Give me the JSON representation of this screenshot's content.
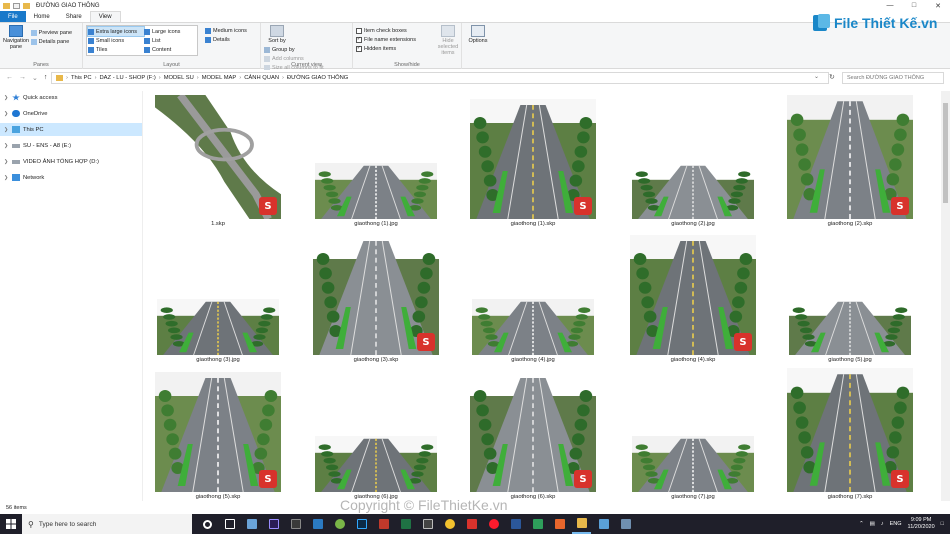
{
  "window": {
    "title": "ĐƯỜNG GIAO THÔNG"
  },
  "tabs": [
    "File",
    "Home",
    "Share",
    "View"
  ],
  "ribbon": {
    "panes": {
      "nav": "Navigation pane",
      "preview": "Preview pane",
      "details": "Details pane",
      "label": "Panes"
    },
    "layout": {
      "xl": "Extra large icons",
      "large": "Large icons",
      "medium": "Medium icons",
      "small": "Small icons",
      "list": "List",
      "details": "Details",
      "tiles": "Tiles",
      "content": "Content",
      "label": "Layout"
    },
    "view": {
      "sort": "Sort by",
      "group": "Group by",
      "addcols": "Add columns",
      "sizecols": "Size all columns to fit",
      "label": "Current view"
    },
    "showhide": {
      "itemcb": "Item check boxes",
      "ext": "File name extensions",
      "hidden": "Hidden items",
      "hidesel": "Hide selected items",
      "label": "Show/hide"
    },
    "options": "Options"
  },
  "logo": {
    "text": "File Thiết Kế.vn"
  },
  "address": {
    "crumbs": [
      "This PC",
      "DAZ - LU - SHOP (F:)",
      "MODEL SU",
      "MODEL MAP",
      "CẢNH QUAN",
      "ĐƯỜNG GIAO THÔNG"
    ],
    "search_placeholder": "Search ĐƯỜNG GIAO THÔNG"
  },
  "nav": {
    "quick": "Quick access",
    "onedrive": "OneDrive",
    "thispc": "This PC",
    "su": "SU - ENS - A8 (E:)",
    "video": "VIDEO ẢNH TỔNG HỢP (D:)",
    "network": "Network"
  },
  "files": [
    "1.skp",
    "giaothong (1).jpg",
    "giaothong (1).skp",
    "giaothong (2).jpg",
    "giaothong (2).skp",
    "giaothong (3).jpg",
    "giaothong (3).skp",
    "giaothong (4).jpg",
    "giaothong (4).skp",
    "giaothong (5).jpg",
    "giaothong (5).skp",
    "giaothong (6).jpg",
    "giaothong (6).skp",
    "giaothong (7).jpg",
    "giaothong (7).skp"
  ],
  "status": {
    "count": "56 items"
  },
  "watermark": "Copyright © FileThietKe.vn",
  "taskbar": {
    "search": "Type here to search",
    "lang": "ENG",
    "time": "9:09 PM",
    "date": "11/20/2020"
  },
  "colors": {
    "accent": "#1979ca",
    "skp": "#d8322c",
    "selected": "#cce8ff"
  }
}
